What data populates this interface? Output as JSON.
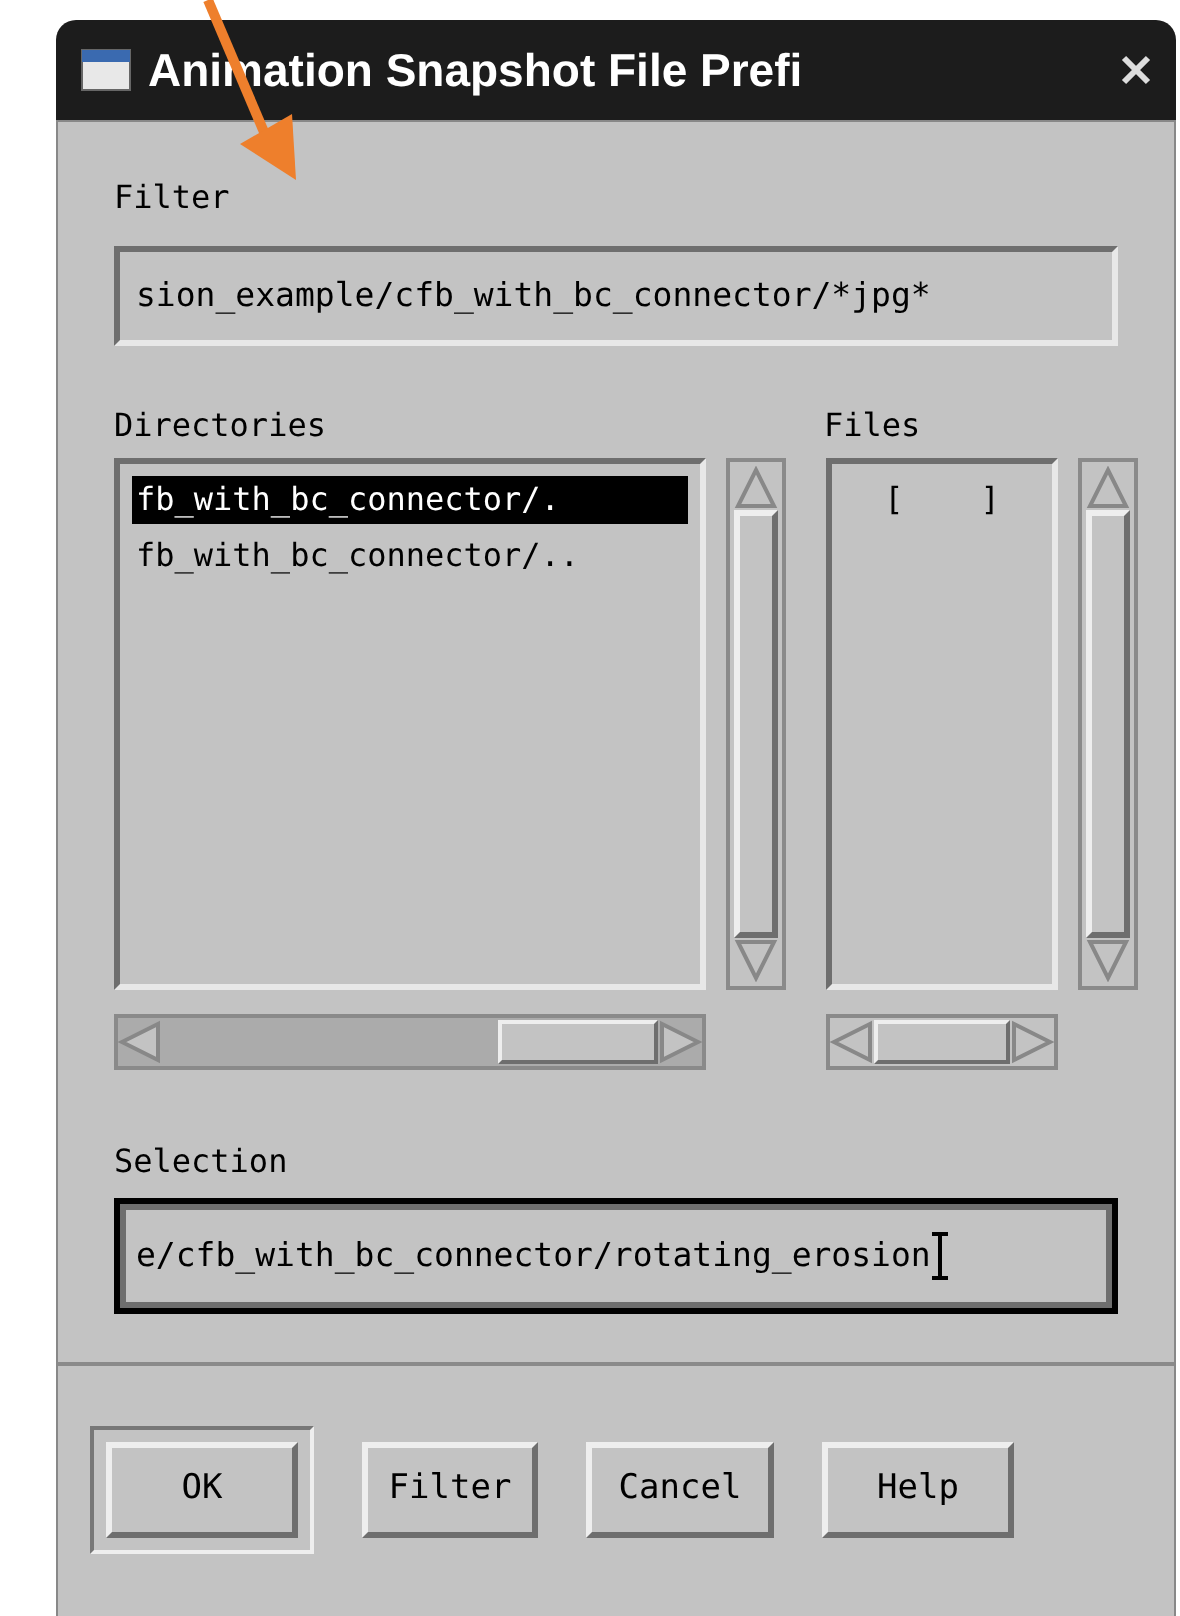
{
  "window": {
    "title": "Animation Snapshot File Prefi"
  },
  "filter": {
    "label": "Filter",
    "value": "sion_example/cfb_with_bc_connector/*jpg*"
  },
  "directories": {
    "label": "Directories",
    "items": [
      {
        "text": "fb_with_bc_connector/.",
        "selected": true
      },
      {
        "text": "fb_with_bc_connector/..",
        "selected": false
      }
    ]
  },
  "files": {
    "label": "Files",
    "items": [
      {
        "text": "[    ]",
        "selected": false
      }
    ]
  },
  "selection": {
    "label": "Selection",
    "value": "e/cfb_with_bc_connector/rotating_erosion",
    "focused": true
  },
  "buttons": [
    {
      "label": "OK",
      "default": true
    },
    {
      "label": "Filter",
      "default": false
    },
    {
      "label": "Cancel",
      "default": false
    },
    {
      "label": "Help",
      "default": false
    }
  ]
}
